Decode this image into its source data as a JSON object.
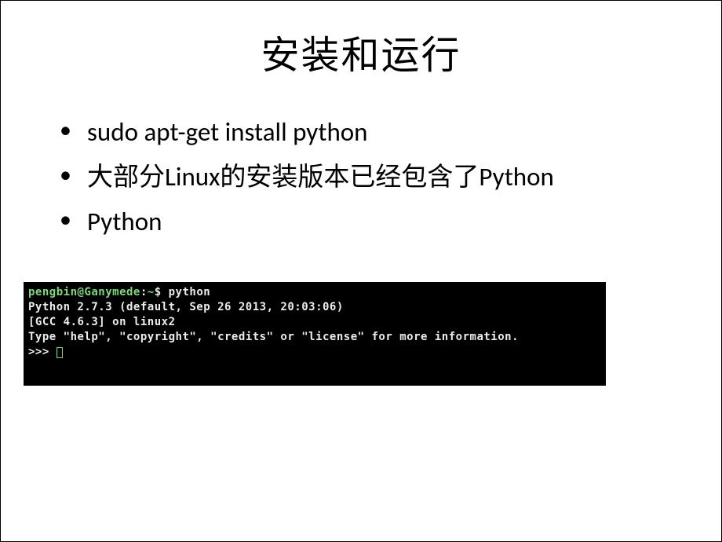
{
  "title": "安装和运行",
  "bullets": [
    "sudo apt-get install python",
    "大部分Linux的安装版本已经包含了Python",
    "Python"
  ],
  "terminal": {
    "prompt_user_host": "pengbin@Ganymede",
    "prompt_path": "~",
    "prompt_sep": ":",
    "prompt_end": "$",
    "cmd": "python",
    "line1": "Python 2.7.3 (default, Sep 26 2013, 20:03:06)",
    "line2": "[GCC 4.6.3] on linux2",
    "line3": "Type \"help\", \"copyright\", \"credits\" or \"license\" for more information.",
    "repl_prompt": ">>> "
  }
}
